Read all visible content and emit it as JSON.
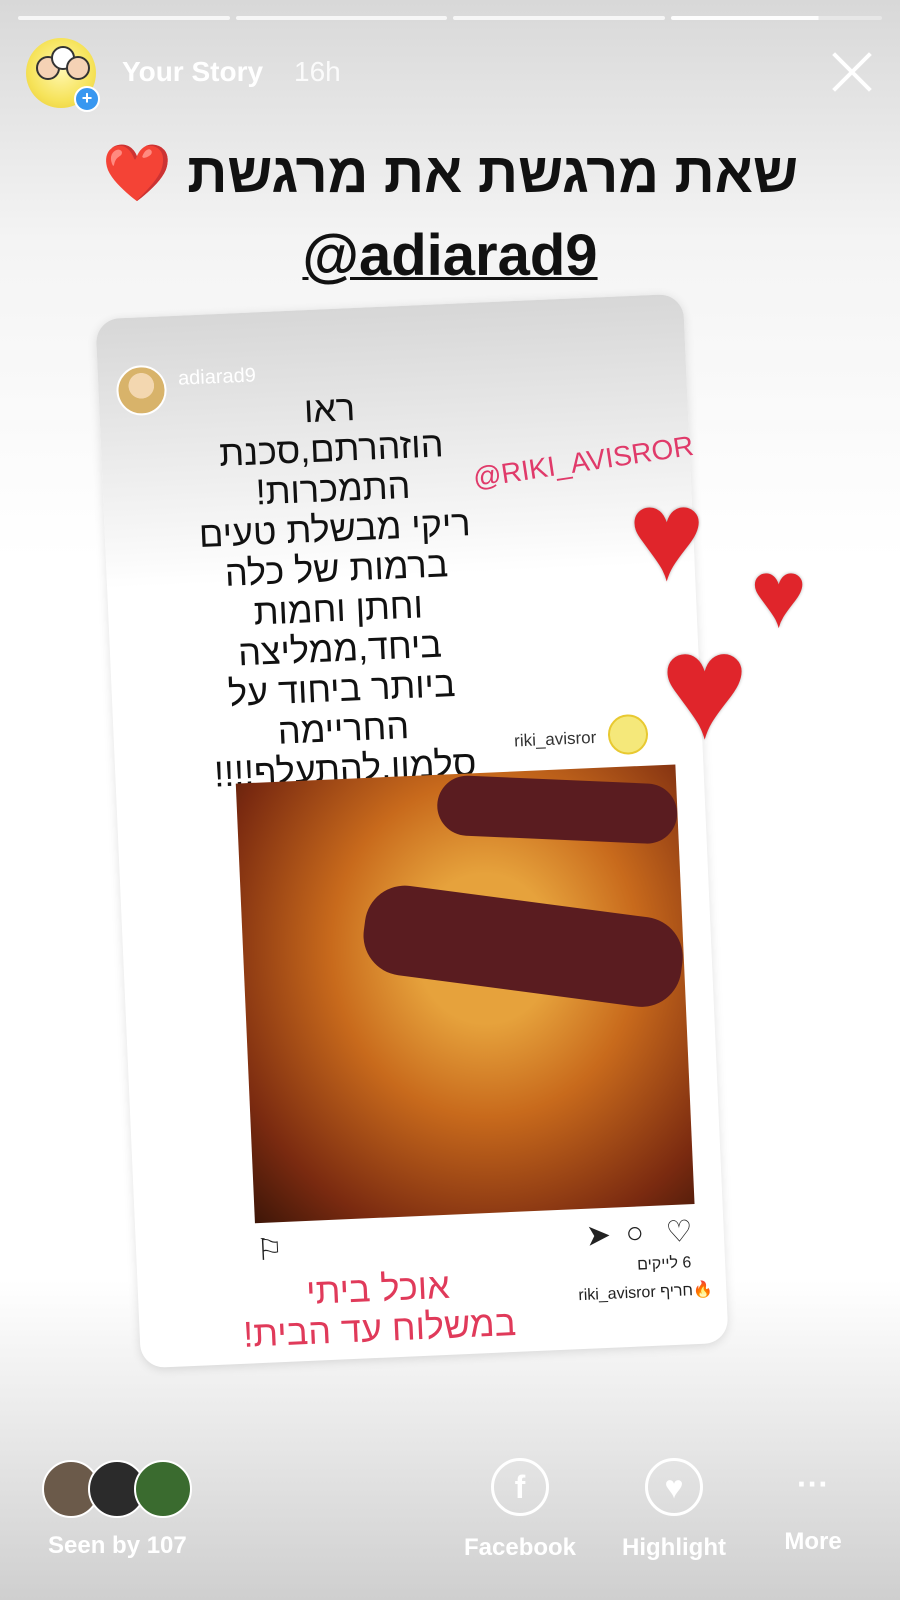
{
  "header": {
    "title": "Your Story",
    "time": "16h",
    "close_icon": "close-icon"
  },
  "story": {
    "headline": "שאת מרגשת את מרגשת ❤️",
    "mention": "@adiarad9",
    "card": {
      "username": "adiarad9",
      "text_lines": [
        "ראו",
        "הוזהרתם,סכנת",
        "התמכרות!",
        "ריקי מבשלת טעים",
        "ברמות של כלה",
        "וחתן וחמות",
        "ביחד,ממליצה",
        "ביותר ביחוד על",
        "החריימה",
        "סלמון,להתעלף!!!!"
      ],
      "tag": "@RIKI_AVISROR",
      "inner_post": {
        "username": "riki_avisror",
        "likes": "6 לייקים",
        "caption": "riki_avisror חריף🔥",
        "promo_line1": "אוכל ביתי",
        "promo_line2": "במשלוח עד הבית!"
      }
    }
  },
  "footer": {
    "seen_by": "Seen by 107",
    "actions": [
      {
        "label": "Facebook",
        "icon": "facebook-icon"
      },
      {
        "label": "Highlight",
        "icon": "highlight-heart-icon"
      },
      {
        "label": "More",
        "icon": "more-dots-icon"
      }
    ]
  }
}
